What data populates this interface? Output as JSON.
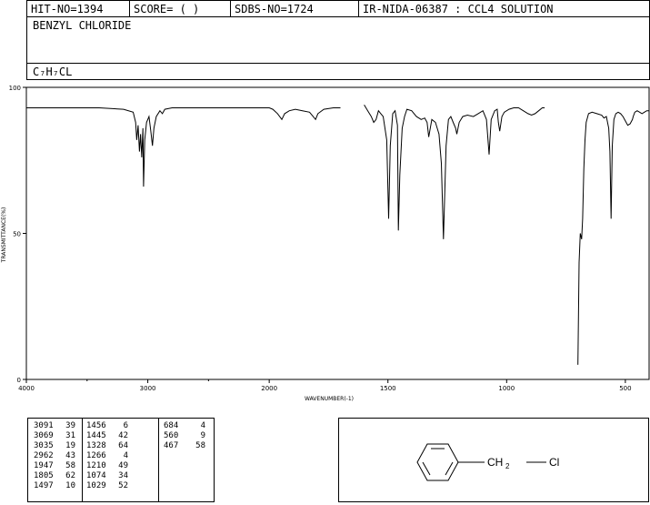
{
  "header": {
    "hit_no": "HIT-NO=1394",
    "score": "SCORE=  (  )",
    "sdbs_no": "SDBS-NO=1724",
    "ir_id": "IR-NIDA-06387 : CCL4 SOLUTION"
  },
  "compound": {
    "name": "BENZYL CHLORIDE",
    "formula": "C₇H₇CL"
  },
  "chart_data": {
    "type": "line",
    "xlabel": "WAVENUMBER(-1)",
    "ylabel": "TRANSMITTANCE(%)",
    "xlim": [
      4000,
      400
    ],
    "ylim": [
      0,
      100
    ],
    "x_ticks": [
      "4000",
      "3000",
      "2000",
      "1500",
      "1000",
      "500"
    ],
    "y_ticks": [
      "100",
      "50",
      "0"
    ],
    "segments": [
      [
        [
          4000,
          93
        ],
        [
          3700,
          93
        ],
        [
          3400,
          93
        ],
        [
          3200,
          92.5
        ],
        [
          3120,
          91.5
        ],
        [
          3100,
          88
        ],
        [
          3091,
          82
        ],
        [
          3080,
          87
        ],
        [
          3069,
          78
        ],
        [
          3060,
          84
        ],
        [
          3050,
          76
        ],
        [
          3040,
          86
        ],
        [
          3035,
          66
        ],
        [
          3025,
          82
        ],
        [
          3010,
          88
        ],
        [
          2990,
          90
        ],
        [
          2975,
          85
        ],
        [
          2962,
          80
        ],
        [
          2950,
          86
        ],
        [
          2930,
          90
        ],
        [
          2900,
          92
        ],
        [
          2880,
          91
        ],
        [
          2860,
          92.5
        ],
        [
          2800,
          93
        ],
        [
          2600,
          93
        ],
        [
          2400,
          93
        ],
        [
          2200,
          93
        ],
        [
          2000,
          93
        ],
        [
          1985,
          92.5
        ],
        [
          1965,
          91
        ],
        [
          1947,
          89
        ],
        [
          1935,
          91
        ],
        [
          1915,
          92
        ],
        [
          1890,
          92.5
        ],
        [
          1860,
          92
        ],
        [
          1830,
          91.5
        ],
        [
          1815,
          90
        ],
        [
          1805,
          89
        ],
        [
          1795,
          91
        ],
        [
          1770,
          92.5
        ],
        [
          1730,
          93
        ],
        [
          1700,
          93
        ]
      ],
      [
        [
          1600,
          94
        ],
        [
          1585,
          92
        ],
        [
          1570,
          90
        ],
        [
          1560,
          88
        ],
        [
          1550,
          89
        ],
        [
          1540,
          92
        ],
        [
          1530,
          91
        ],
        [
          1520,
          90
        ],
        [
          1505,
          82
        ],
        [
          1497,
          55
        ],
        [
          1490,
          80
        ],
        [
          1480,
          91
        ],
        [
          1470,
          92
        ],
        [
          1460,
          87
        ],
        [
          1456,
          51
        ],
        [
          1450,
          70
        ],
        [
          1445,
          78
        ],
        [
          1440,
          86
        ],
        [
          1430,
          90
        ],
        [
          1420,
          92.5
        ],
        [
          1400,
          92
        ],
        [
          1380,
          90
        ],
        [
          1360,
          89
        ],
        [
          1345,
          89.5
        ],
        [
          1335,
          88
        ],
        [
          1328,
          83
        ],
        [
          1315,
          89
        ],
        [
          1300,
          88
        ],
        [
          1285,
          84
        ],
        [
          1275,
          74
        ],
        [
          1266,
          48
        ],
        [
          1255,
          80
        ],
        [
          1245,
          89
        ],
        [
          1235,
          90
        ],
        [
          1225,
          88
        ],
        [
          1215,
          86
        ],
        [
          1210,
          84
        ],
        [
          1200,
          88
        ],
        [
          1185,
          90
        ],
        [
          1165,
          90.5
        ],
        [
          1140,
          90
        ],
        [
          1120,
          91
        ],
        [
          1100,
          92
        ],
        [
          1085,
          89
        ],
        [
          1074,
          77
        ],
        [
          1065,
          89
        ],
        [
          1050,
          92
        ],
        [
          1040,
          92.5
        ],
        [
          1035,
          88
        ],
        [
          1029,
          85
        ],
        [
          1020,
          90
        ],
        [
          1010,
          91.5
        ],
        [
          990,
          92.5
        ],
        [
          970,
          93
        ],
        [
          950,
          93
        ],
        [
          930,
          92
        ],
        [
          910,
          91
        ],
        [
          895,
          90.5
        ],
        [
          880,
          91
        ],
        [
          865,
          92
        ],
        [
          850,
          93
        ],
        [
          840,
          93
        ]
      ],
      [
        [
          700,
          5
        ],
        [
          695,
          40
        ],
        [
          690,
          50
        ],
        [
          684,
          48
        ],
        [
          680,
          55
        ],
        [
          675,
          72
        ],
        [
          670,
          82
        ],
        [
          665,
          88
        ],
        [
          655,
          91
        ],
        [
          640,
          91.5
        ],
        [
          620,
          91
        ],
        [
          600,
          90.5
        ],
        [
          590,
          89.5
        ],
        [
          580,
          90
        ],
        [
          570,
          86
        ],
        [
          565,
          78
        ],
        [
          560,
          55
        ],
        [
          555,
          80
        ],
        [
          548,
          89
        ],
        [
          540,
          91
        ],
        [
          530,
          91.5
        ],
        [
          520,
          91
        ],
        [
          510,
          90
        ],
        [
          500,
          88.5
        ],
        [
          490,
          87
        ],
        [
          480,
          87.5
        ],
        [
          470,
          89
        ],
        [
          467,
          90
        ],
        [
          460,
          91.5
        ],
        [
          450,
          92
        ],
        [
          440,
          91.5
        ],
        [
          430,
          91
        ],
        [
          420,
          91.5
        ],
        [
          410,
          92
        ],
        [
          400,
          92
        ]
      ]
    ]
  },
  "peaks": {
    "columns": [
      [
        [
          "3091",
          "39"
        ],
        [
          "3069",
          "31"
        ],
        [
          "3035",
          "19"
        ],
        [
          "2962",
          "43"
        ],
        [
          "1947",
          "58"
        ],
        [
          "1805",
          "62"
        ],
        [
          "1497",
          "10"
        ]
      ],
      [
        [
          "1456",
          "6"
        ],
        [
          "1445",
          "42"
        ],
        [
          "1328",
          "64"
        ],
        [
          "1266",
          "4"
        ],
        [
          "1210",
          "49"
        ],
        [
          "1074",
          "34"
        ],
        [
          "1029",
          "52"
        ]
      ],
      [
        [
          "684",
          "4"
        ],
        [
          "560",
          "9"
        ],
        [
          "467",
          "58"
        ]
      ]
    ]
  },
  "structure": {
    "ch2_label": "CH",
    "ch2_sub": "2",
    "cl_label": "Cl"
  }
}
